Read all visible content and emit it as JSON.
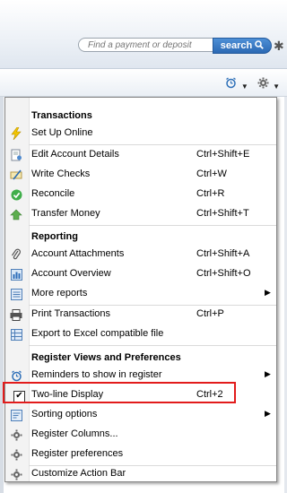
{
  "search": {
    "placeholder": "Find a payment or deposit",
    "button_label": "search"
  },
  "menu": {
    "sections": {
      "transactions": "Transactions",
      "reporting": "Reporting",
      "register_views": "Register Views and Preferences"
    },
    "items": {
      "setup_online": {
        "label": "Set Up Online",
        "icon": "lightning-icon"
      },
      "edit_account": {
        "label": "Edit Account Details",
        "shortcut": "Ctrl+Shift+E",
        "icon": "edit-account-icon"
      },
      "write_checks": {
        "label": "Write Checks",
        "shortcut": "Ctrl+W",
        "icon": "write-checks-icon"
      },
      "reconcile": {
        "label": "Reconcile",
        "shortcut": "Ctrl+R",
        "icon": "reconcile-icon"
      },
      "transfer_money": {
        "label": "Transfer Money",
        "shortcut": "Ctrl+Shift+T",
        "icon": "transfer-icon"
      },
      "account_attachments": {
        "label": "Account Attachments",
        "shortcut": "Ctrl+Shift+A",
        "icon": "paperclip-icon"
      },
      "account_overview": {
        "label": "Account Overview",
        "shortcut": "Ctrl+Shift+O",
        "icon": "overview-icon"
      },
      "more_reports": {
        "label": "More reports",
        "icon": "reports-icon"
      },
      "print_transactions": {
        "label": "Print Transactions",
        "shortcut": "Ctrl+P",
        "icon": "printer-icon"
      },
      "export_excel": {
        "label": "Export to Excel compatible file",
        "icon": "excel-icon"
      },
      "reminders": {
        "label": "Reminders to show in register",
        "icon": "alarm-clock-icon"
      },
      "two_line": {
        "label": "Two-line Display",
        "shortcut": "Ctrl+2",
        "checked": true
      },
      "sorting": {
        "label": "Sorting options",
        "icon": "sort-icon"
      },
      "register_columns": {
        "label": "Register Columns...",
        "icon": "gear-icon"
      },
      "register_prefs": {
        "label": "Register preferences",
        "icon": "gear-icon"
      },
      "customize_bar": {
        "label": "Customize Action Bar",
        "icon": "gear-icon"
      }
    }
  },
  "colors": {
    "highlight_border": "#e21b1b",
    "accent": "#2c69b4"
  }
}
